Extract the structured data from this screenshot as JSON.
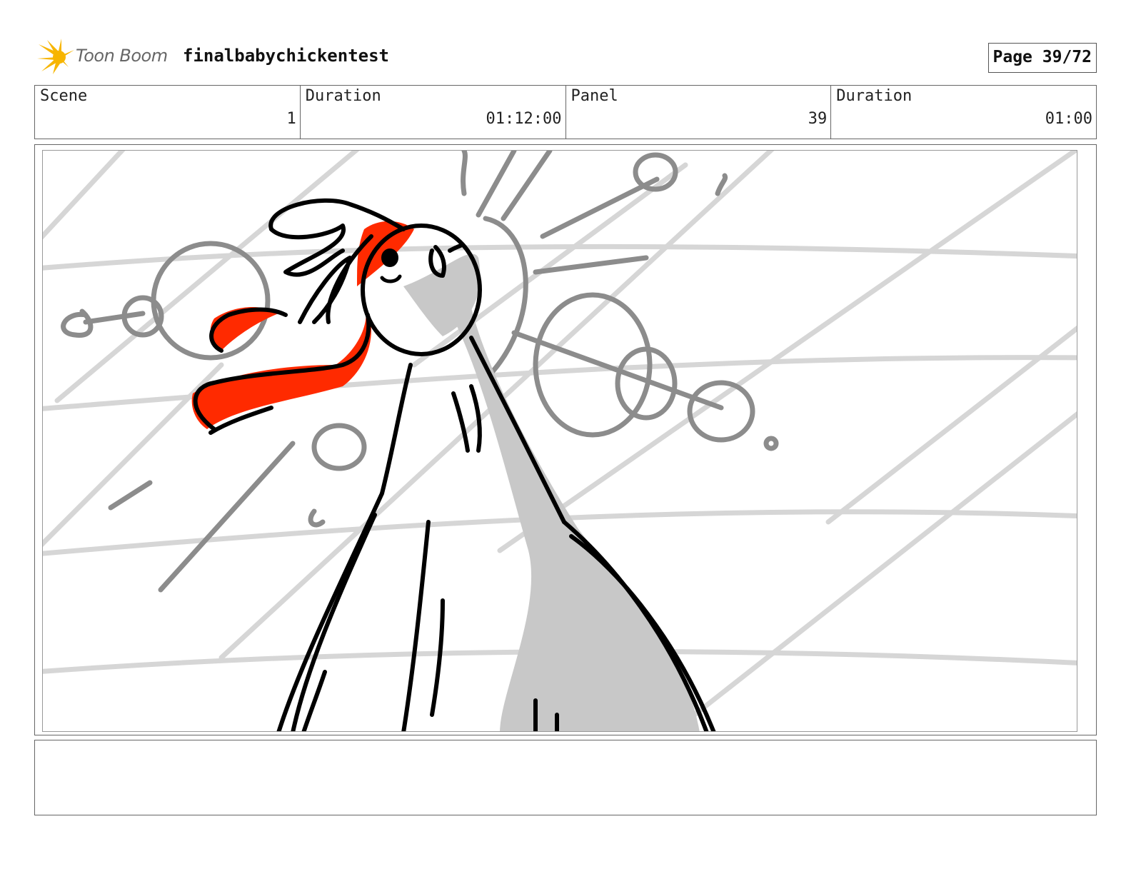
{
  "header": {
    "logo_text": "Toon Boom",
    "project_title": "finalbabychickentest",
    "page_indicator": "Page 39/72"
  },
  "info": {
    "scene_label": "Scene",
    "scene_value": "1",
    "scene_duration_label": "Duration",
    "scene_duration_value": "01:12:00",
    "panel_label": "Panel",
    "panel_value": "39",
    "panel_duration_label": "Duration",
    "panel_duration_value": "01:00"
  },
  "panel": {
    "sketch_colors": {
      "ink": "#000000",
      "gray_tone": "#c8c8c8",
      "mid_gray": "#8c8c8c",
      "light_lines": "#d6d6d6",
      "red_accent": "#ff2a00"
    }
  },
  "notes": {
    "text": ""
  },
  "logo_colors": {
    "burst": "#f7b500",
    "text": "#666666"
  }
}
